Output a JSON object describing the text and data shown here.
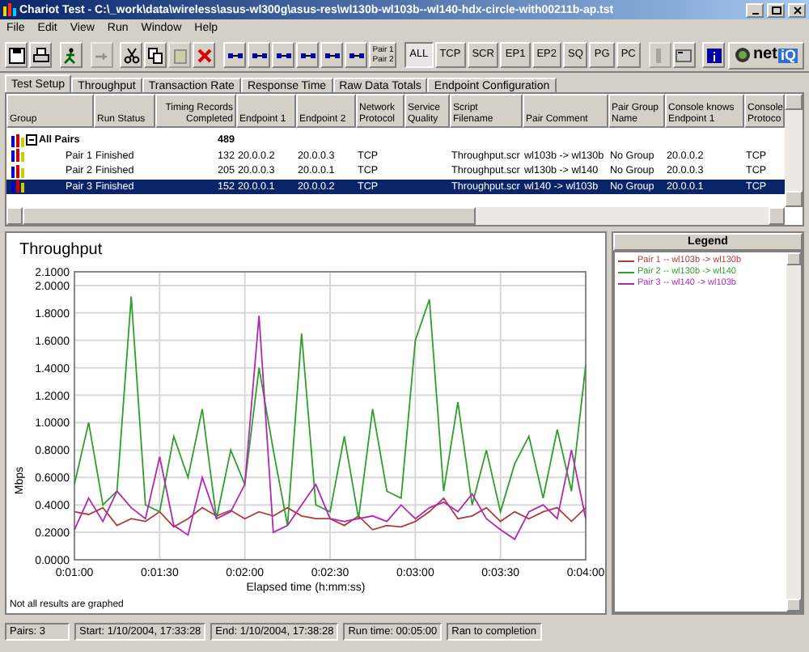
{
  "window": {
    "title": "Chariot Test - C:\\_work\\data\\wireless\\asus-wl300g\\asus-res\\wl130b-wl103b--wl140-hdx-circle-with00211b-ap.tst"
  },
  "menu": [
    "File",
    "Edit",
    "View",
    "Run",
    "Window",
    "Help"
  ],
  "toolbar": {
    "pair_button": [
      "Pair 1",
      "Pair 2"
    ],
    "filters": [
      {
        "label": "ALL",
        "selected": true
      },
      {
        "label": "TCP",
        "selected": false
      },
      {
        "label": "SCR",
        "selected": false
      },
      {
        "label": "EP1",
        "selected": false
      },
      {
        "label": "EP2",
        "selected": false
      },
      {
        "label": "SQ",
        "selected": false
      },
      {
        "label": "PG",
        "selected": false
      },
      {
        "label": "PC",
        "selected": false
      }
    ],
    "logo": {
      "text": "net",
      "badge": "iQ"
    }
  },
  "tabs": [
    {
      "label": "Test Setup",
      "selected": true
    },
    {
      "label": "Throughput",
      "selected": false
    },
    {
      "label": "Transaction Rate",
      "selected": false
    },
    {
      "label": "Response Time",
      "selected": false
    },
    {
      "label": "Raw Data Totals",
      "selected": false
    },
    {
      "label": "Endpoint Configuration",
      "selected": false
    }
  ],
  "table": {
    "columns": [
      "Group",
      "Run Status",
      "Timing Records Completed",
      "Endpoint 1",
      "Endpoint 2",
      "Network Protocol",
      "Service Quality",
      "Script Filename",
      "Pair Comment",
      "Pair Group Name",
      "Console knows Endpoint 1",
      "Console Protoco"
    ],
    "rows": [
      {
        "kind": "group",
        "group": "All Pairs",
        "expanded": true,
        "records": "489",
        "selected": false
      },
      {
        "kind": "pair",
        "group": "Pair 1",
        "status": "Finished",
        "records": "132",
        "endpoint_1": "20.0.0.2",
        "endpoint_2": "20.0.0.3",
        "protocol": "TCP",
        "script": "Throughput.scr",
        "comment": "wl103b -> wl130b",
        "pair_group": "No Group",
        "console_endpoint_1": "20.0.0.2",
        "console_protocol": "TCP",
        "selected": false
      },
      {
        "kind": "pair",
        "group": "Pair 2",
        "status": "Finished",
        "records": "205",
        "endpoint_1": "20.0.0.3",
        "endpoint_2": "20.0.0.1",
        "protocol": "TCP",
        "script": "Throughput.scr",
        "comment": "wl130b -> wl140",
        "pair_group": "No Group",
        "console_endpoint_1": "20.0.0.3",
        "console_protocol": "TCP",
        "selected": false
      },
      {
        "kind": "pair",
        "group": "Pair 3",
        "status": "Finished",
        "records": "152",
        "endpoint_1": "20.0.0.1",
        "endpoint_2": "20.0.0.2",
        "protocol": "TCP",
        "script": "Throughput.scr",
        "comment": "wl140 -> wl103b",
        "pair_group": "No Group",
        "console_endpoint_1": "20.0.0.1",
        "console_protocol": "TCP",
        "selected": true
      }
    ]
  },
  "graph": {
    "note": "Not all results are graphed",
    "legend_title": "Legend",
    "chart_data": {
      "type": "line",
      "title": "Throughput",
      "xlabel": "Elapsed time (h:mm:ss)",
      "ylabel": "Mbps",
      "x": [
        60,
        65,
        70,
        75,
        80,
        85,
        90,
        95,
        100,
        105,
        110,
        115,
        120,
        125,
        130,
        135,
        140,
        145,
        150,
        155,
        160,
        165,
        170,
        175,
        180,
        185,
        190,
        195,
        200,
        205,
        210,
        215,
        220,
        225,
        230,
        235,
        240
      ],
      "series": [
        {
          "name": "Pair 1 -- wl103b -> wl130b",
          "color": "#b03c3c",
          "values": [
            0.35,
            0.33,
            0.38,
            0.25,
            0.3,
            0.28,
            0.35,
            0.24,
            0.3,
            0.38,
            0.32,
            0.36,
            0.3,
            0.35,
            0.32,
            0.38,
            0.32,
            0.3,
            0.3,
            0.25,
            0.32,
            0.22,
            0.25,
            0.24,
            0.28,
            0.35,
            0.45,
            0.3,
            0.32,
            0.38,
            0.28,
            0.35,
            0.3,
            0.35,
            0.38,
            0.28,
            0.38
          ]
        },
        {
          "name": "Pair 2 -- wl130b -> wl140",
          "color": "#2e9e2e",
          "values": [
            0.55,
            1.0,
            0.4,
            0.5,
            1.92,
            0.4,
            0.35,
            0.9,
            0.6,
            1.1,
            0.3,
            0.8,
            0.55,
            1.4,
            0.8,
            0.25,
            1.65,
            0.4,
            0.35,
            0.9,
            0.3,
            1.1,
            0.5,
            0.45,
            1.6,
            1.9,
            0.5,
            1.15,
            0.4,
            0.8,
            0.35,
            0.7,
            0.9,
            0.45,
            0.95,
            0.5,
            1.42
          ]
        },
        {
          "name": "Pair 3 -- wl140 -> wl103b",
          "color": "#b02ab0",
          "values": [
            0.22,
            0.45,
            0.28,
            0.5,
            0.38,
            0.3,
            0.75,
            0.25,
            0.18,
            0.6,
            0.3,
            0.35,
            0.55,
            1.78,
            0.2,
            0.25,
            0.4,
            0.55,
            0.3,
            0.28,
            0.3,
            0.32,
            0.28,
            0.4,
            0.3,
            0.38,
            0.42,
            0.35,
            0.48,
            0.3,
            0.22,
            0.15,
            0.35,
            0.4,
            0.3,
            0.8,
            0.3
          ]
        }
      ],
      "grid": true,
      "xlim": [
        60,
        240
      ],
      "ylim": [
        0,
        2.1
      ],
      "xticks": [
        {
          "value": 60,
          "label": "0:01:00"
        },
        {
          "value": 90,
          "label": "0:01:30"
        },
        {
          "value": 120,
          "label": "0:02:00"
        },
        {
          "value": 150,
          "label": "0:02:30"
        },
        {
          "value": 180,
          "label": "0:03:00"
        },
        {
          "value": 210,
          "label": "0:03:30"
        },
        {
          "value": 240,
          "label": "0:04:00"
        }
      ],
      "yticks": [
        {
          "value": 0,
          "label": "0.0000"
        },
        {
          "value": 0.2,
          "label": "0.2000"
        },
        {
          "value": 0.4,
          "label": "0.4000"
        },
        {
          "value": 0.6,
          "label": "0.6000"
        },
        {
          "value": 0.8,
          "label": "0.8000"
        },
        {
          "value": 1.0,
          "label": "1.0000"
        },
        {
          "value": 1.2,
          "label": "1.2000"
        },
        {
          "value": 1.4,
          "label": "1.4000"
        },
        {
          "value": 1.6,
          "label": "1.6000"
        },
        {
          "value": 1.8,
          "label": "1.8000"
        },
        {
          "value": 2.0,
          "label": "2.0000"
        },
        {
          "value": 2.1,
          "label": "2.1000"
        }
      ]
    }
  },
  "status_bar": [
    "Pairs: 3",
    "Start: 1/10/2004, 17:33:28",
    "End: 1/10/2004, 17:38:28",
    "Run time: 00:05:00",
    "Ran to completion"
  ]
}
